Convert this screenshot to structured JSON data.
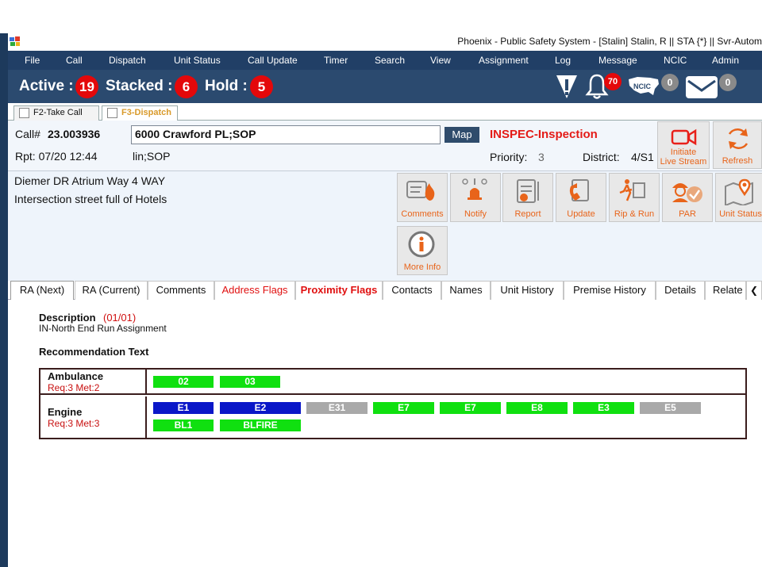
{
  "window": {
    "title": "Phoenix - Public Safety System - [Stalin] Stalin, R || STA {*} || Svr-Autom"
  },
  "menu": [
    "File",
    "Call",
    "Dispatch",
    "Unit Status",
    "Call Update",
    "Timer",
    "Search",
    "View",
    "Assignment",
    "Log",
    "Message",
    "NCIC",
    "Admin"
  ],
  "counts": {
    "active_label": "Active :",
    "active": "19",
    "stacked_label": "Stacked :",
    "stacked": "6",
    "hold_label": "Hold :",
    "hold": "5",
    "notifications": "70",
    "ncic_label": "NCIC",
    "ncic": "0",
    "messages": "0"
  },
  "ftabs": [
    {
      "label": "F2-Take Call"
    },
    {
      "label": "F3-Dispatch"
    }
  ],
  "call": {
    "call_label": "Call#",
    "call_number": "23.003936",
    "address": "6000 Crawford PL;SOP",
    "map_label": "Map",
    "type": "INSPEC-Inspection",
    "rpt": "Rpt: 07/20 12:44",
    "location_code": "lin;SOP",
    "priority_label": "Priority:",
    "priority": "3",
    "district_label": "District:",
    "district": "4/S1",
    "live_label_1": "Initiate",
    "live_label_2": "Live Stream",
    "refresh_label": "Refresh"
  },
  "notes": [
    "Diemer DR  Atrium Way 4 WAY",
    "Intersection street full of Hotels"
  ],
  "actions": [
    "Comments",
    "Notify",
    "Report",
    "Update",
    "Rip & Run",
    "PAR",
    "Unit Status",
    "More Info"
  ],
  "lower_tabs": [
    "RA (Next)",
    "RA (Current)",
    "Comments",
    "Address Flags",
    "Proximity Flags",
    "Contacts",
    "Names",
    "Unit History",
    "Premise History",
    "Details",
    "Relate"
  ],
  "ra": {
    "desc_label": "Description",
    "desc_count": "(01/01)",
    "desc_text": "IN-North End Run Assignment",
    "rec_label": "Recommendation Text",
    "rows": [
      {
        "name": "Ambulance",
        "req": "Req:3  Met:2",
        "units": [
          {
            "id": "02",
            "color": "green"
          },
          {
            "id": "03",
            "color": "green"
          }
        ]
      },
      {
        "name": "Engine",
        "req": "Req:3  Met:3",
        "units": [
          {
            "id": "E1",
            "color": "blue"
          },
          {
            "id": "E2",
            "color": "blue"
          },
          {
            "id": "E31",
            "color": "gray"
          },
          {
            "id": "E7",
            "color": "green"
          },
          {
            "id": "E7",
            "color": "green"
          },
          {
            "id": "E8",
            "color": "green"
          },
          {
            "id": "E3",
            "color": "green"
          },
          {
            "id": "E5",
            "color": "gray"
          },
          {
            "id": "BL1",
            "color": "green"
          },
          {
            "id": "BLFIRE",
            "color": "green"
          }
        ]
      }
    ]
  },
  "colors": {
    "accent": "#e8641a",
    "menu_bg": "#213f66",
    "badge": "#e4080a",
    "unit_green": "#10e010",
    "unit_blue": "#0a17c8",
    "unit_gray": "#a9a9a9"
  }
}
